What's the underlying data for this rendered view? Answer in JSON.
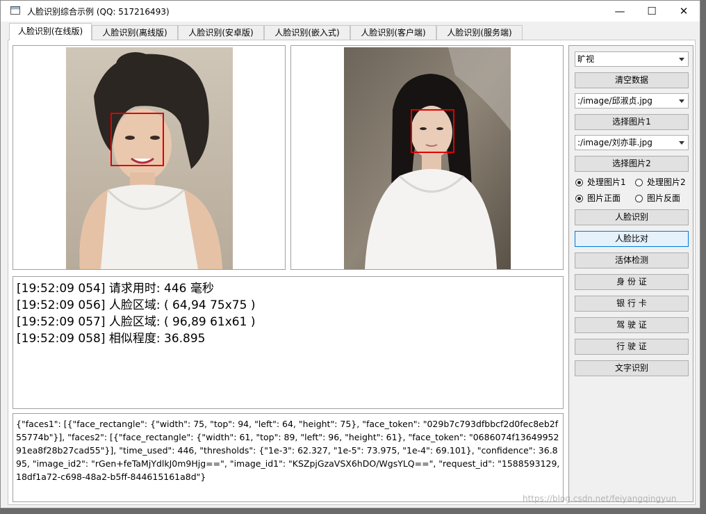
{
  "window": {
    "title": "人脸识别综合示例 (QQ: 517216493)",
    "minimize": "—",
    "maximize": "☐",
    "close": "✕"
  },
  "tabs": [
    {
      "label": "人脸识别(在线版)"
    },
    {
      "label": "人脸识别(离线版)"
    },
    {
      "label": "人脸识别(安卓版)"
    },
    {
      "label": "人脸识别(嵌入式)"
    },
    {
      "label": "人脸识别(客户端)"
    },
    {
      "label": "人脸识别(服务端)"
    }
  ],
  "log": [
    "[19:52:09 054] 请求用时: 446 毫秒",
    "[19:52:09 056] 人脸区域: ( 64,94 75x75 )",
    "[19:52:09 057] 人脸区域: ( 96,89 61x61 )",
    "[19:52:09 058] 相似程度: 36.895"
  ],
  "json_output": "{\"faces1\": [{\"face_rectangle\": {\"width\": 75, \"top\": 94, \"left\": 64, \"height\": 75}, \"face_token\": \"029b7c793dfbbcf2d0fec8eb2f55774b\"}], \"faces2\": [{\"face_rectangle\": {\"width\": 61, \"top\": 89, \"left\": 96, \"height\": 61}, \"face_token\": \"0686074f1364995291ea8f28b27cad55\"}], \"time_used\": 446, \"thresholds\": {\"1e-3\": 62.327, \"1e-5\": 73.975, \"1e-4\": 69.101}, \"confidence\": 36.895, \"image_id2\": \"rGen+feTaMjYdlkJ0m9Hjg==\", \"image_id1\": \"KSZpjGzaVSX6hDO/WgsYLQ==\", \"request_id\": \"1588593129,18df1a72-c698-48a2-b5ff-844615161a8d\"}",
  "sidebar": {
    "provider": "旷视",
    "clear_label": "清空数据",
    "image1_path": ":/image/邱淑贞.jpg",
    "select1_label": "选择图片1",
    "image2_path": ":/image/刘亦菲.jpg",
    "select2_label": "选择图片2",
    "radio_process1": "处理图片1",
    "radio_process2": "处理图片2",
    "radio_front": "图片正面",
    "radio_back": "图片反面",
    "face_recognize": "人脸识别",
    "face_compare": "人脸比对",
    "liveness": "活体检测",
    "id_card": "身 份 证",
    "bank_card": "银 行 卡",
    "driver_license": "驾 驶 证",
    "vehicle_license": "行 驶 证",
    "text_recognize": "文字识别"
  },
  "watermark": "https://blog.csdn.net/feiyangqingyun",
  "colors": {
    "face_box": "#e00000",
    "accent": "#0078d7"
  }
}
